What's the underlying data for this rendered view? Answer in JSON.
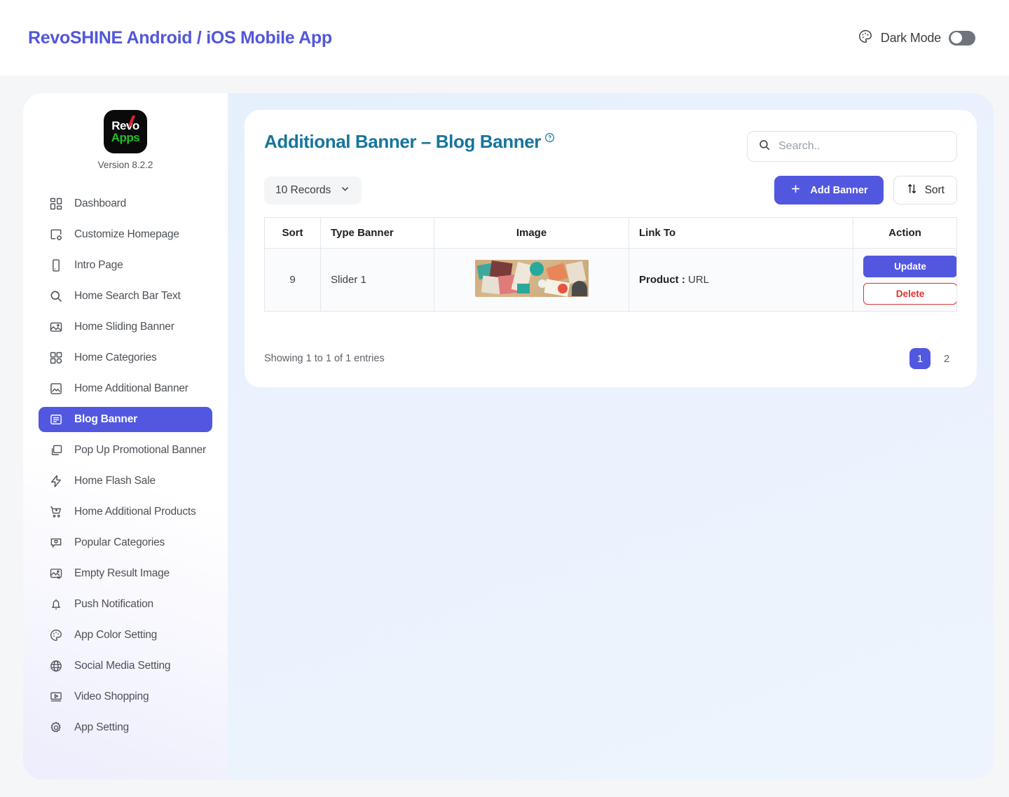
{
  "topbar": {
    "brand_title": "RevoSHINE Android / iOS Mobile App",
    "dark_mode_label": "Dark Mode",
    "dark_mode_on": false,
    "palette_icon": "palette-icon"
  },
  "sidebar": {
    "logo_line1": "Revo",
    "logo_line2": "Apps",
    "version": "Version 8.2.2",
    "items": [
      {
        "label": "Dashboard",
        "icon": "dashboard-grid-icon",
        "active": false
      },
      {
        "label": "Customize Homepage",
        "icon": "layout-settings-icon",
        "active": false
      },
      {
        "label": "Intro Page",
        "icon": "mobile-phone-icon",
        "active": false
      },
      {
        "label": "Home Search Bar Text",
        "icon": "search-icon",
        "active": false
      },
      {
        "label": "Home Sliding Banner",
        "icon": "image-stack-icon",
        "active": false
      },
      {
        "label": "Home Categories",
        "icon": "grid-category-icon",
        "active": false
      },
      {
        "label": "Home Additional Banner",
        "icon": "image-frame-icon",
        "active": false
      },
      {
        "label": "Blog Banner",
        "icon": "article-icon",
        "active": true
      },
      {
        "label": "Pop Up Promotional Banner",
        "icon": "popup-window-icon",
        "active": false
      },
      {
        "label": "Home Flash Sale",
        "icon": "lightning-bolt-icon",
        "active": false
      },
      {
        "label": "Home Additional Products",
        "icon": "cart-plus-icon",
        "active": false
      },
      {
        "label": "Popular Categories",
        "icon": "heart-chat-icon",
        "active": false
      },
      {
        "label": "Empty Result Image",
        "icon": "image-x-icon",
        "active": false
      },
      {
        "label": "Push Notification",
        "icon": "bell-icon",
        "active": false
      },
      {
        "label": "App Color Setting",
        "icon": "palette-icon",
        "active": false
      },
      {
        "label": "Social Media Setting",
        "icon": "globe-icon",
        "active": false
      },
      {
        "label": "Video Shopping",
        "icon": "video-play-icon",
        "active": false
      },
      {
        "label": "App Setting",
        "icon": "gear-icon",
        "active": false
      }
    ]
  },
  "main": {
    "page_title": "Additional Banner – Blog Banner",
    "help_icon": "question-circle-icon",
    "search": {
      "placeholder": "Search..",
      "value": "",
      "icon": "search-icon"
    },
    "records_select": {
      "selected": "10 Records",
      "chevron_icon": "chevron-down-icon"
    },
    "add_button": {
      "label": "Add Banner",
      "icon": "plus-icon"
    },
    "sort_button": {
      "label": "Sort",
      "icon": "sort-arrows-icon"
    },
    "table": {
      "headers": [
        "Sort",
        "Type Banner",
        "Image",
        "Link To",
        "Action"
      ],
      "rows": [
        {
          "sort": "9",
          "type_banner": "Slider 1",
          "image_alt": "craft-supplies-banner-thumbnail",
          "link_label": "Product :",
          "link_value": "URL",
          "update_label": "Update",
          "delete_label": "Delete"
        }
      ]
    },
    "entries_text": "Showing 1 to 1 of 1 entries",
    "pagination": {
      "pages": [
        {
          "label": "1",
          "active": true
        },
        {
          "label": "2",
          "active": false
        }
      ]
    }
  },
  "colors": {
    "brand_indigo": "#5257e0",
    "title_teal": "#17759c",
    "delete_red": "#e03131",
    "logo_green": "#22c024",
    "logo_red": "#e8202a",
    "content_bg": "#e8f1fd"
  }
}
